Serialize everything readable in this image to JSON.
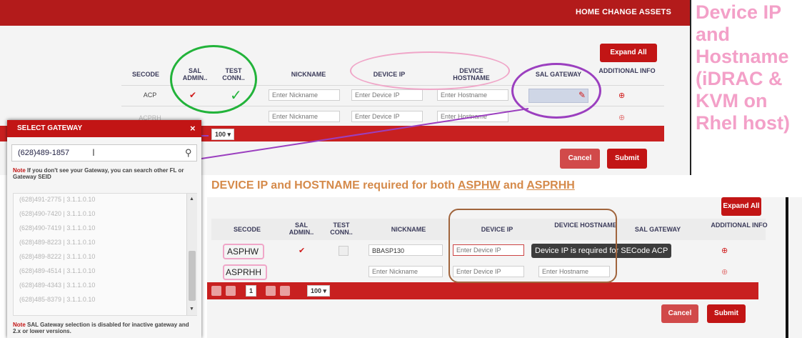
{
  "top": {
    "nav": "HOME  CHANGE ASSETS",
    "expand_all": "Expand All",
    "columns": [
      "SECODE",
      "SAL ADMIN..",
      "TEST CONN..",
      "NICKNAME",
      "DEVICE IP",
      "DEVICE HOSTNAME",
      "SAL GATEWAY",
      "ADDITIONAL INFO"
    ],
    "rows": [
      {
        "secode": "ACP",
        "nickname": "Enter Nickname",
        "device_ip": "Enter Device IP",
        "hostname": "Enter Hostname"
      },
      {
        "secode": "ACPRH",
        "nickname": "Enter Nickname",
        "device_ip": "Enter Device IP",
        "hostname": "Enter Hostname"
      }
    ],
    "page_size": "100",
    "cancel": "Cancel",
    "submit": "Submit"
  },
  "annotation_right": "Device IP and Hostname (iDRAC & KVM on Rhel host)",
  "annotation_mid": {
    "prefix": "DEVICE IP and HOSTNAME required for both ",
    "a": "ASPHW",
    "mid": " and ",
    "b": "ASPRHH"
  },
  "modal": {
    "title": "SELECT GATEWAY",
    "close": "×",
    "search_value": "(628)489-1857",
    "note1_label": "Note",
    "note1": " If you don't see your Gateway, you can search other FL or Gateway SEID",
    "options": [
      "(628)491-2775 | 3.1.1.0.10",
      "(628)490-7420 | 3.1.1.0.10",
      "(628)490-7419 | 3.1.1.0.10",
      "(628)489-8223 | 3.1.1.0.10",
      "(628)489-8222 | 3.1.1.0.10",
      "(628)489-4514 | 3.1.1.0.10",
      "(628)489-4343 | 3.1.1.0.10",
      "(628)485-8379 | 3.1.1.0.10"
    ],
    "note2_label": "Note",
    "note2": " SAL Gateway selection is disabled for inactive gateway and 2.x or lower versions."
  },
  "bottom": {
    "expand_all": "Expand All",
    "columns": [
      "SECODE",
      "SAL ADMIN..",
      "TEST CONN..",
      "NICKNAME",
      "DEVICE IP",
      "DEVICE HOSTNAME",
      "SAL GATEWAY",
      "ADDITIONAL INFO"
    ],
    "rows": [
      {
        "secode": "ASPHW",
        "nickname": "BBASP130",
        "device_ip": "Enter Device IP",
        "hostname": ""
      },
      {
        "secode": "ASPRHH",
        "nickname": "Enter Nickname",
        "device_ip": "Enter Device IP",
        "hostname": "Enter Hostname"
      }
    ],
    "tooltip": "Device IP is required for SECode ACP",
    "page_current": "1",
    "page_size": "100",
    "cancel": "Cancel",
    "submit": "Submit"
  },
  "colors": {
    "brand_red": "#c21515",
    "annotation_pink": "#f3a0c8",
    "annotation_orange": "#d58a4a",
    "green_circle": "#22b33a",
    "purple_circle": "#9b3fbf",
    "brown_box": "#a0643c"
  }
}
